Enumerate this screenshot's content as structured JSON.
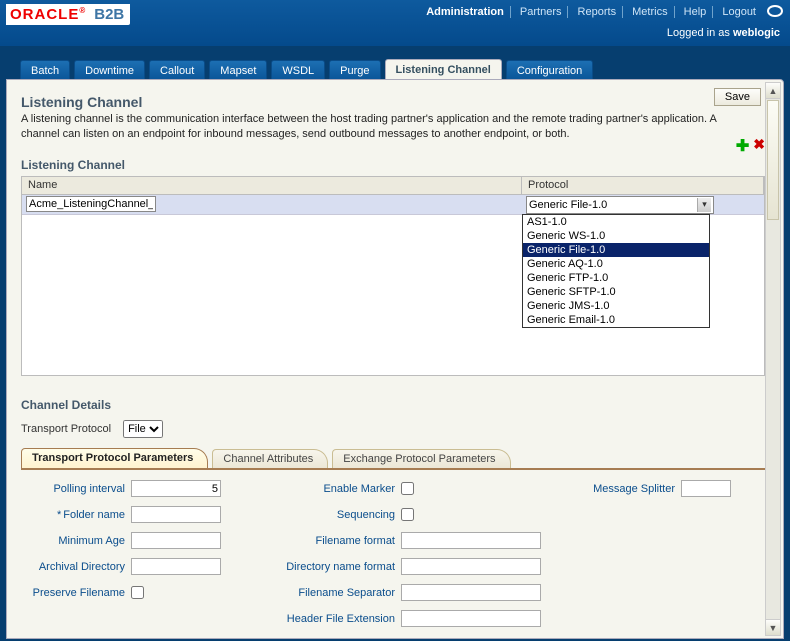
{
  "header": {
    "brand1": "ORACLE",
    "brand2": "B2B",
    "links": [
      "Administration",
      "Partners",
      "Reports",
      "Metrics",
      "Help",
      "Logout"
    ],
    "active_link_index": 0,
    "login_prefix": "Logged in as ",
    "login_user": "weblogic"
  },
  "tabs": {
    "items": [
      "Batch",
      "Downtime",
      "Callout",
      "Mapset",
      "WSDL",
      "Purge",
      "Listening Channel",
      "Configuration"
    ],
    "active_index": 6
  },
  "page": {
    "title": "Listening Channel",
    "description": "A listening channel is the communication interface between the host trading partner's application and the remote trading partner's application. A channel can listen on an endpoint for inbound messages, send outbound messages to another endpoint, or both.",
    "save_label": "Save"
  },
  "listening": {
    "section_title": "Listening Channel",
    "col_name": "Name",
    "col_proto": "Protocol",
    "row_name": "Acme_ListeningChannel_",
    "proto_selected": "Generic File-1.0",
    "proto_options": [
      "AS1-1.0",
      "Generic WS-1.0",
      "Generic File-1.0",
      "Generic AQ-1.0",
      "Generic FTP-1.0",
      "Generic SFTP-1.0",
      "Generic JMS-1.0",
      "Generic Email-1.0"
    ],
    "proto_highlight_index": 2
  },
  "details": {
    "section_title": "Channel Details",
    "tp_label": "Transport Protocol",
    "tp_value": "File",
    "subtabs": [
      "Transport Protocol Parameters",
      "Channel Attributes",
      "Exchange Protocol Parameters"
    ],
    "subtab_active": 0,
    "col1": {
      "polling_interval": {
        "label": "Polling interval",
        "value": "5"
      },
      "folder_name": {
        "label": "Folder name",
        "value": ""
      },
      "minimum_age": {
        "label": "Minimum Age",
        "value": ""
      },
      "archival_directory": {
        "label": "Archival Directory",
        "value": ""
      },
      "preserve_filename": {
        "label": "Preserve Filename",
        "checked": false
      }
    },
    "col2": {
      "enable_marker": {
        "label": "Enable Marker",
        "checked": false
      },
      "sequencing": {
        "label": "Sequencing",
        "checked": false
      },
      "filename_format": {
        "label": "Filename format",
        "value": ""
      },
      "directory_name_format": {
        "label": "Directory name format",
        "value": ""
      },
      "filename_separator": {
        "label": "Filename Separator",
        "value": ""
      },
      "header_file_extension": {
        "label": "Header File Extension",
        "value": ""
      }
    },
    "col3": {
      "message_splitter": {
        "label": "Message Splitter",
        "value": ""
      }
    }
  }
}
